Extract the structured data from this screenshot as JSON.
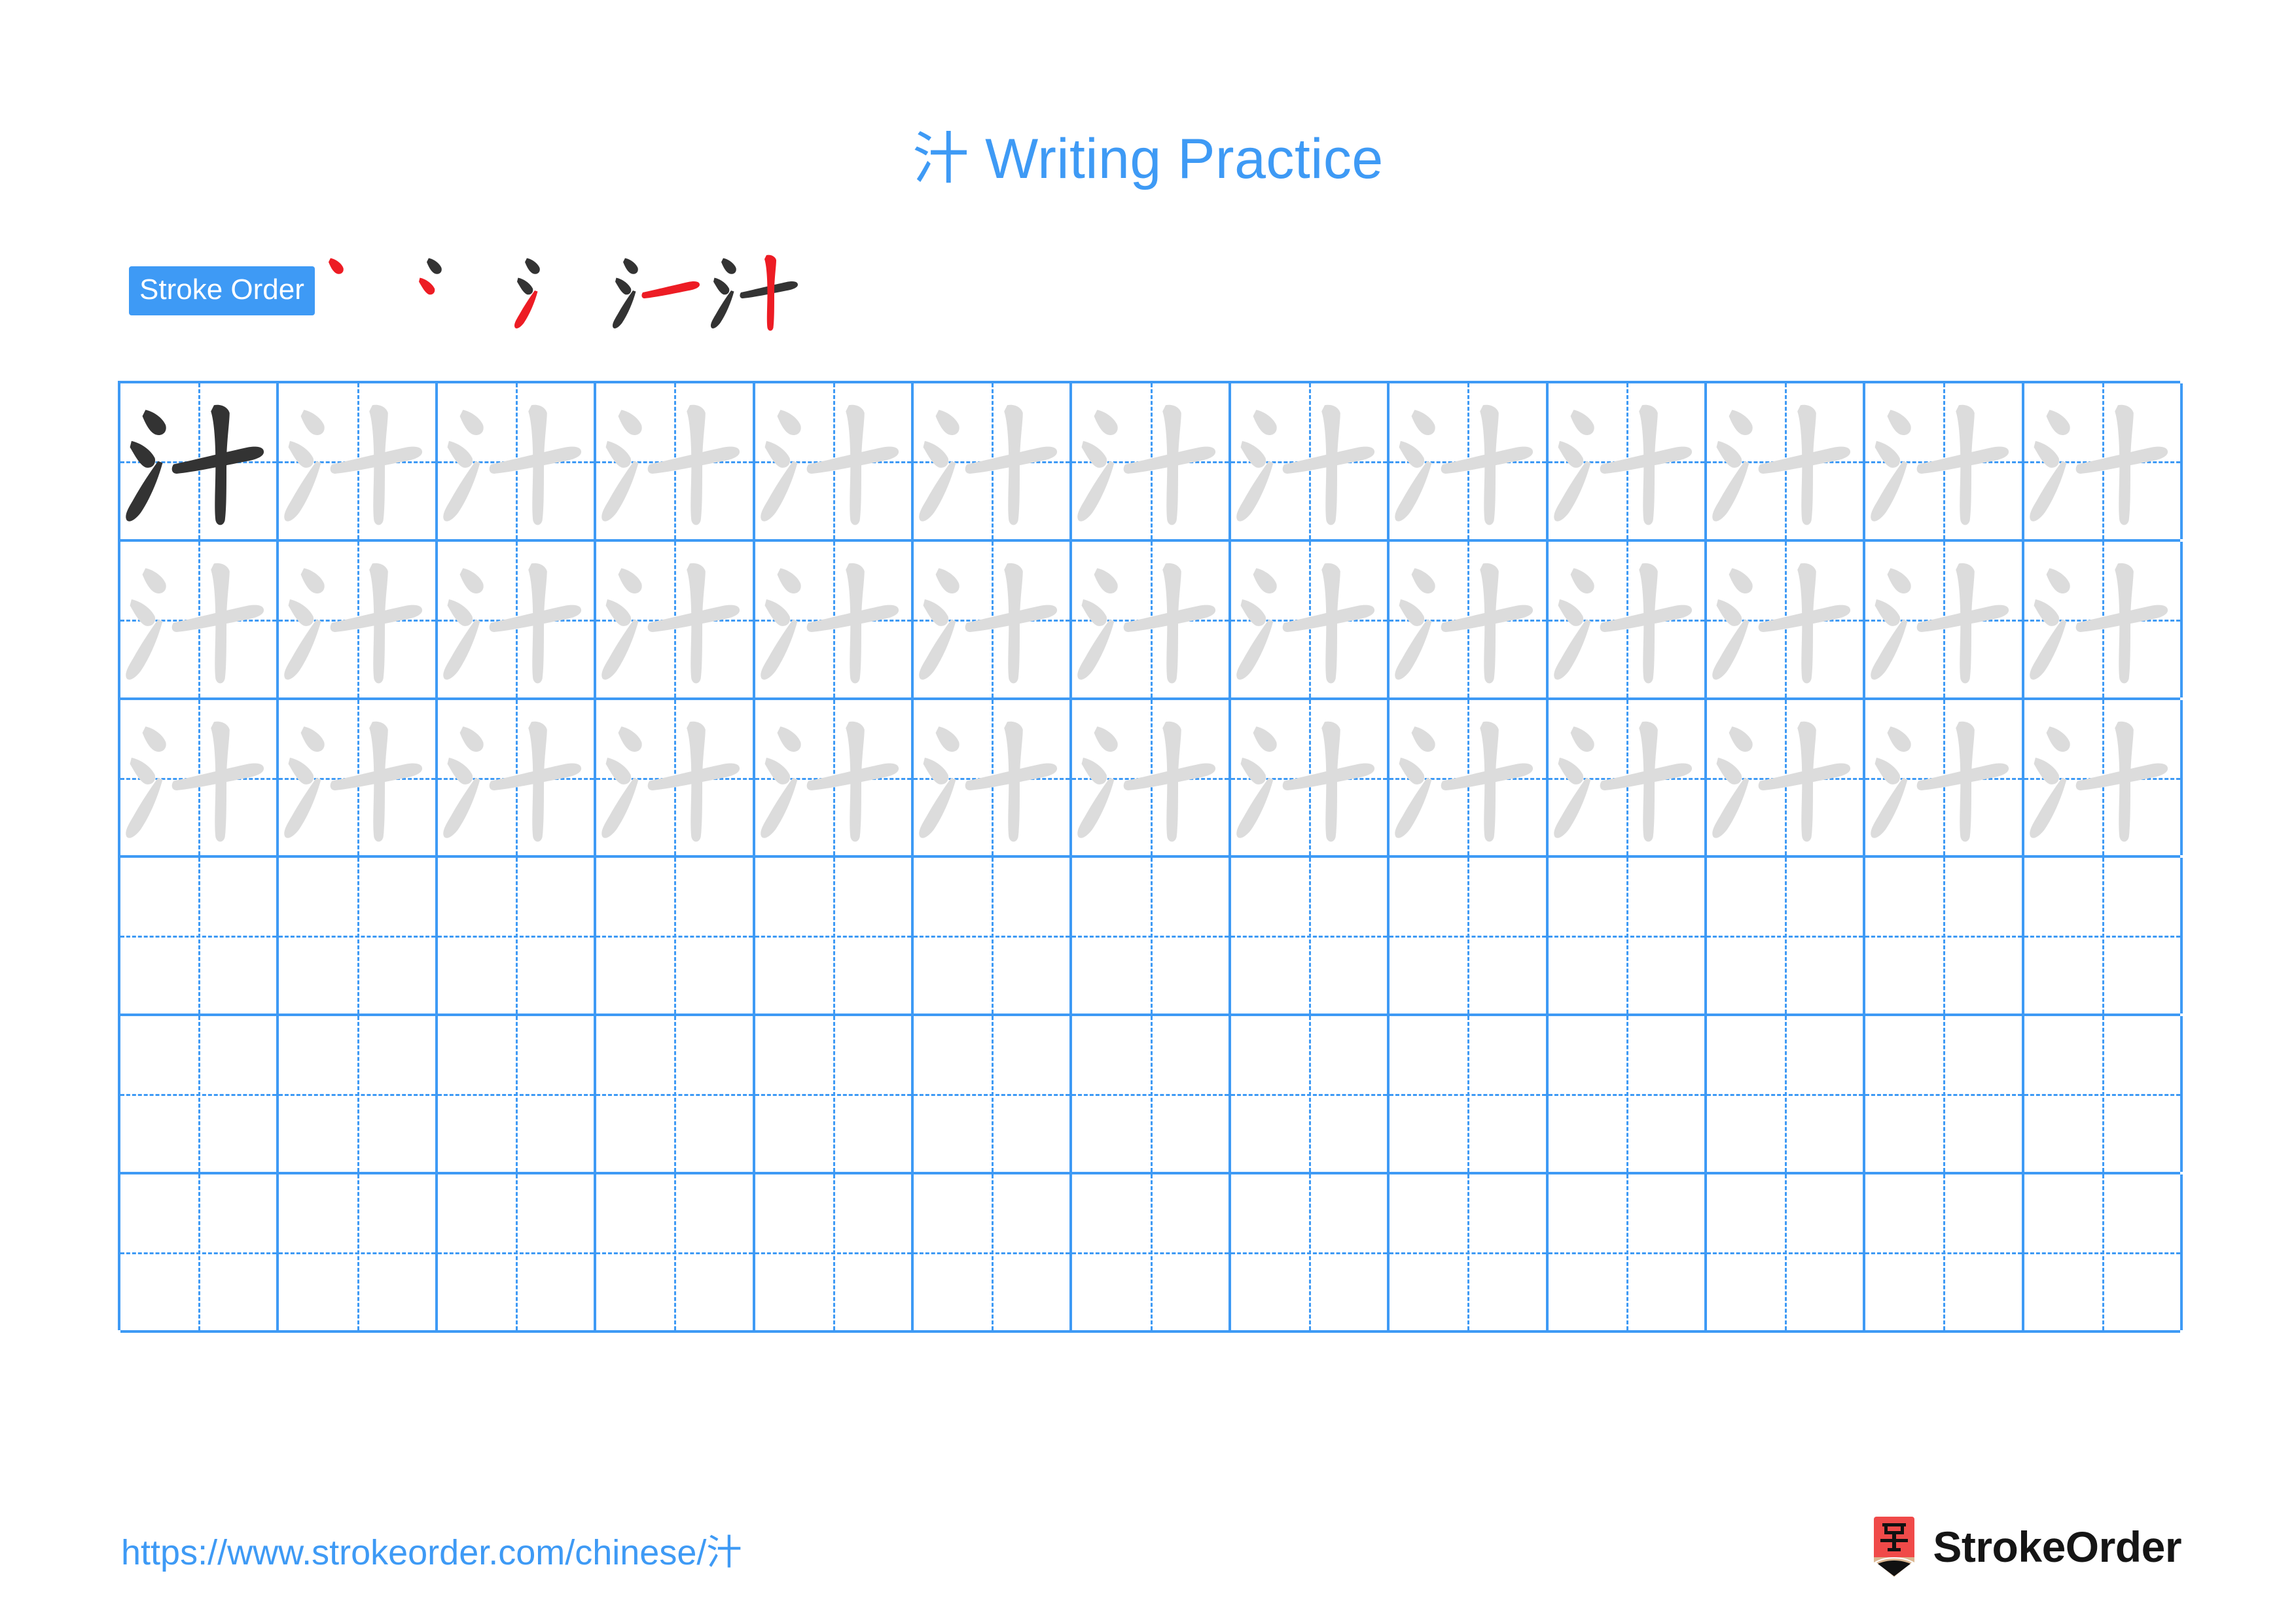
{
  "page": {
    "character": "汁",
    "title": "汁 Writing Practice",
    "title_color": "#3E9AF5",
    "background": "#ffffff"
  },
  "stroke_order": {
    "badge_label": "Stroke Order",
    "badge_bg": "#3E9AF5",
    "badge_text_color": "#ffffff",
    "new_stroke_color": "#ED1C24",
    "prior_stroke_color": "#333333",
    "total_strokes": 5,
    "steps": [
      {
        "index": 1,
        "strokes_shown": 1,
        "new_stroke": "dot-1"
      },
      {
        "index": 2,
        "strokes_shown": 2,
        "new_stroke": "dot-2"
      },
      {
        "index": 3,
        "strokes_shown": 3,
        "new_stroke": "upward-flick"
      },
      {
        "index": 4,
        "strokes_shown": 4,
        "new_stroke": "horizontal"
      },
      {
        "index": 5,
        "strokes_shown": 5,
        "new_stroke": "vertical"
      }
    ]
  },
  "grid": {
    "columns": 13,
    "rows": 6,
    "line_color": "#3E9AF5",
    "guide_color": "#3E9AF5",
    "traced_glyph_color": "#DCDCDC",
    "model_glyph_color": "#333333",
    "rows_data": [
      {
        "row": 1,
        "cells": [
          "model",
          "trace",
          "trace",
          "trace",
          "trace",
          "trace",
          "trace",
          "trace",
          "trace",
          "trace",
          "trace",
          "trace",
          "trace"
        ]
      },
      {
        "row": 2,
        "cells": [
          "trace",
          "trace",
          "trace",
          "trace",
          "trace",
          "trace",
          "trace",
          "trace",
          "trace",
          "trace",
          "trace",
          "trace",
          "trace"
        ]
      },
      {
        "row": 3,
        "cells": [
          "trace",
          "trace",
          "trace",
          "trace",
          "trace",
          "trace",
          "trace",
          "trace",
          "trace",
          "trace",
          "trace",
          "trace",
          "trace"
        ]
      },
      {
        "row": 4,
        "cells": [
          "empty",
          "empty",
          "empty",
          "empty",
          "empty",
          "empty",
          "empty",
          "empty",
          "empty",
          "empty",
          "empty",
          "empty",
          "empty"
        ]
      },
      {
        "row": 5,
        "cells": [
          "empty",
          "empty",
          "empty",
          "empty",
          "empty",
          "empty",
          "empty",
          "empty",
          "empty",
          "empty",
          "empty",
          "empty",
          "empty"
        ]
      },
      {
        "row": 6,
        "cells": [
          "empty",
          "empty",
          "empty",
          "empty",
          "empty",
          "empty",
          "empty",
          "empty",
          "empty",
          "empty",
          "empty",
          "empty",
          "empty"
        ]
      }
    ]
  },
  "footer": {
    "url": "https://www.strokeorder.com/chinese/汁",
    "url_color": "#3E9AF5",
    "brand_name": "StrokeOrder",
    "brand_icon_character": "字",
    "brand_icon_color": "#F04A49",
    "brand_icon_wood_color": "#DCB791",
    "brand_icon_tip_color": "#111111"
  }
}
